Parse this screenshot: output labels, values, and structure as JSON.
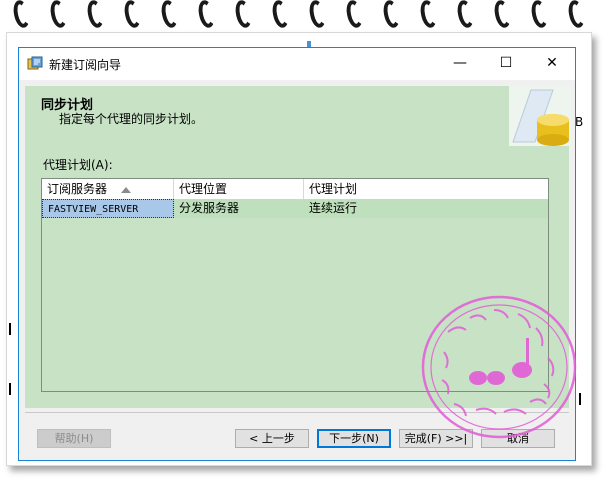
{
  "window": {
    "title": "新建订阅向导",
    "controls": {
      "minimize": "—",
      "maximize": "☐",
      "close": "✕"
    }
  },
  "header": {
    "title": "同步计划",
    "subtitle": "指定每个代理的同步计划。"
  },
  "main": {
    "section_label": "代理计划(A):",
    "table": {
      "columns": [
        "订阅服务器",
        "代理位置",
        "代理计划"
      ],
      "rows": [
        [
          "FASTVIEW_SERVER",
          "分发服务器",
          "连续运行"
        ]
      ]
    }
  },
  "buttons": {
    "help": "帮助(H)",
    "back": "< 上一步",
    "next": "下一步(N)",
    "finish": "完成(F) >>|",
    "cancel": "取消"
  },
  "background": {
    "side_text": "B"
  },
  "colors": {
    "panel": "#c8e2c6",
    "selection": "#a9c7e8",
    "window_border": "#1883d7",
    "stamp": "#e35bd7"
  },
  "icons": [
    "app-icon",
    "minimize-icon",
    "maximize-icon",
    "close-icon",
    "sort-ascending-icon",
    "database-icon"
  ]
}
